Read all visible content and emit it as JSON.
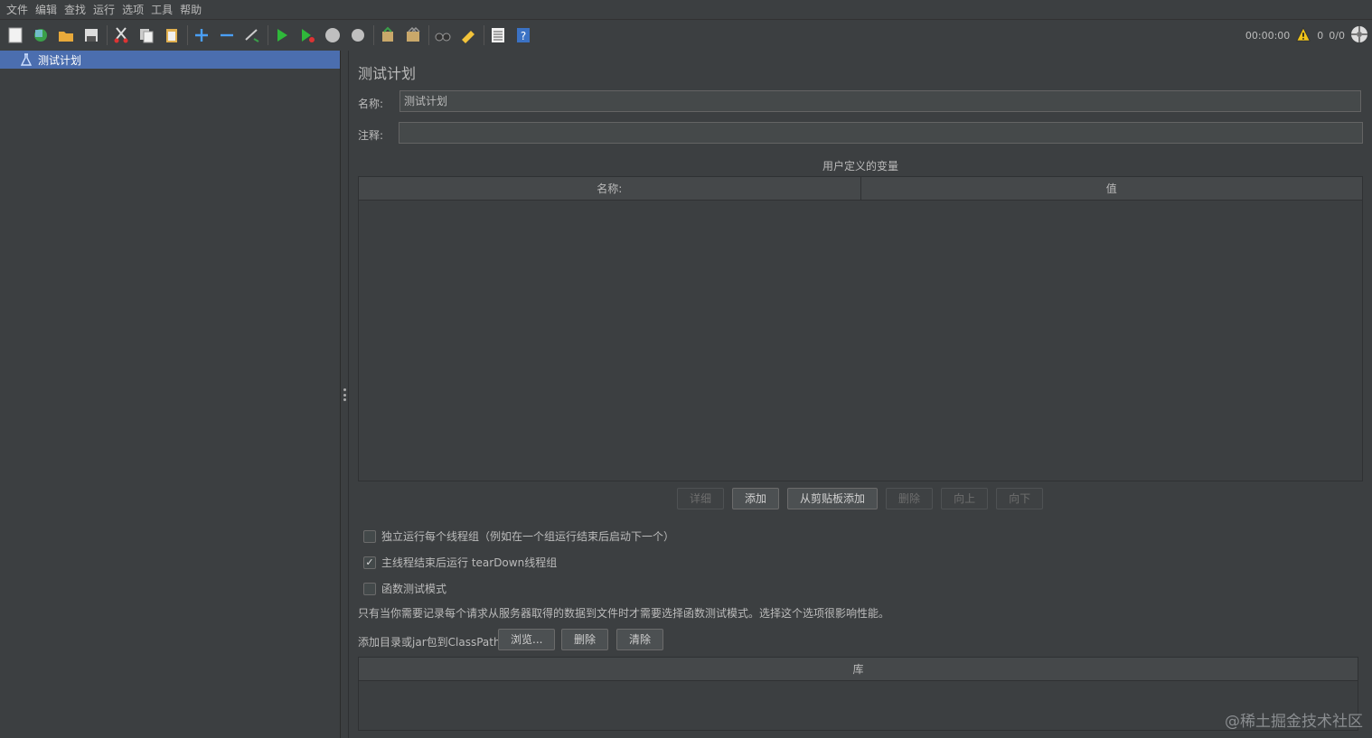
{
  "menu": [
    "文件",
    "编辑",
    "查找",
    "运行",
    "选项",
    "工具",
    "帮助"
  ],
  "toolbar": {
    "icons": [
      "new-icon",
      "templates-icon",
      "open-icon",
      "save-icon",
      "cut-icon",
      "copy-icon",
      "paste-icon",
      "expand-icon",
      "collapse-icon",
      "toggle-icon",
      "start-icon",
      "start-no-pause-icon",
      "stop-icon",
      "shutdown-icon",
      "clear-icon",
      "clear-all-icon",
      "search-icon",
      "reset-search-icon",
      "function-helper-icon",
      "help-icon"
    ],
    "timer": "00:00:00",
    "warn_count": "0",
    "threads": "0/0"
  },
  "tree": {
    "selected_label": "测试计划"
  },
  "main": {
    "title": "测试计划",
    "name_label": "名称:",
    "name_value": "测试计划",
    "comment_label": "注释:",
    "comment_value": "",
    "section_title": "用户定义的变量",
    "table_headers": [
      "名称:",
      "值"
    ],
    "buttons": {
      "detail": "详细",
      "add": "添加",
      "add_from_clipboard": "从剪贴板添加",
      "delete": "删除",
      "up": "向上",
      "down": "向下"
    },
    "checkboxes": {
      "serialize_label": "独立运行每个线程组（例如在一个组运行结束后启动下一个）",
      "serialize_checked": false,
      "teardown_label": "主线程结束后运行 tearDown线程组",
      "teardown_checked": true,
      "functional_label": "函数测试模式",
      "functional_checked": false
    },
    "functional_note": "只有当你需要记录每个请求从服务器取得的数据到文件时才需要选择函数测试模式。选择这个选项很影响性能。",
    "classpath_label": "添加目录或jar包到ClassPath",
    "classpath_buttons": {
      "browse": "浏览...",
      "delete": "删除",
      "clear": "清除"
    },
    "library_header": "库"
  },
  "watermark": "@稀土掘金技术社区",
  "colors": {
    "background": "#3c3f41",
    "selection": "#4b6eaf",
    "text": "#bbbbbb"
  }
}
